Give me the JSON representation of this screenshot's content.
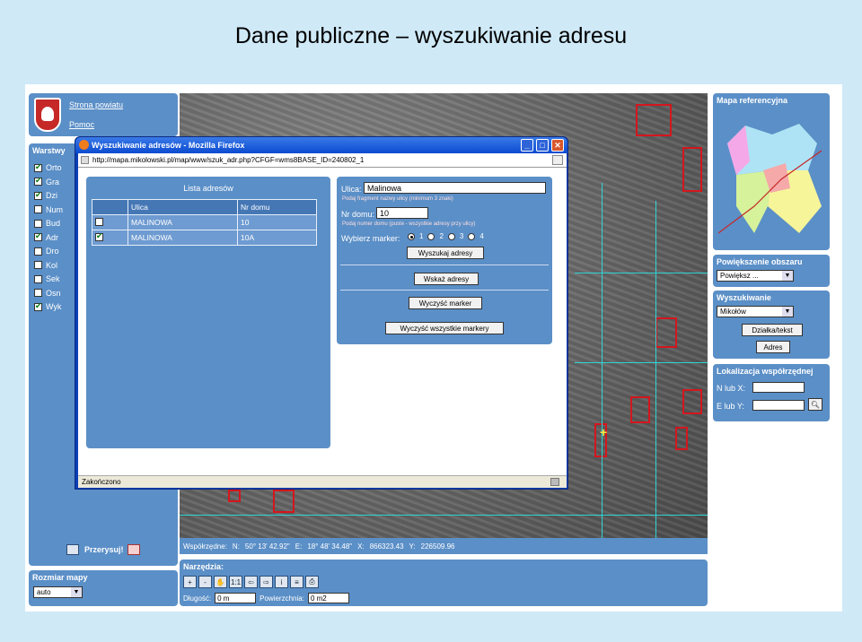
{
  "slide": {
    "title": "Dane publiczne – wyszukiwanie adresu"
  },
  "left_panel": {
    "links": [
      "Strona powiatu",
      "Pomoc"
    ],
    "layers_title": "Warstwy",
    "layers": [
      {
        "label": "Orto",
        "checked": true
      },
      {
        "label": "Gra",
        "checked": true
      },
      {
        "label": "Dzi",
        "checked": true
      },
      {
        "label": "Num",
        "checked": false
      },
      {
        "label": "Bud",
        "checked": false
      },
      {
        "label": "Adr",
        "checked": true
      },
      {
        "label": "Dro",
        "checked": false
      },
      {
        "label": "Kol",
        "checked": false
      },
      {
        "label": "Sek",
        "checked": false
      },
      {
        "label": "Osn",
        "checked": false
      },
      {
        "label": "Wyk",
        "checked": true
      }
    ],
    "redraw_label": "Przerysuj!",
    "map_size_title": "Rozmiar mapy",
    "map_size_value": "auto"
  },
  "coords_bar": {
    "label": "Współrzędne:",
    "n_label": "N:",
    "n_value": "50° 13' 42.92\"",
    "e_label": "E:",
    "e_value": "18° 48' 34.48\"",
    "x_label": "X:",
    "x_value": "866323.43",
    "y_label": "Y:",
    "y_value": "226509.96"
  },
  "tools": {
    "title": "Narzędzia:",
    "buttons": [
      "+",
      "-",
      "✋",
      "1:1",
      "⇦",
      "⇨",
      "i",
      "≡",
      "⎙"
    ],
    "length_label": "Długość:",
    "length_value": "0 m",
    "area_label": "Powierzchnia:",
    "area_value": "0 m2"
  },
  "right_panel": {
    "ref_title": "Mapa referencyjna",
    "zoom_title": "Powiększenie obszaru",
    "zoom_value": "Powiększ ...",
    "search_title": "Wyszukiwanie",
    "search_value": "Mikołów",
    "parcel_btn": "Działka/tekst",
    "address_btn": "Adres",
    "coord_title": "Lokalizacja współrzędnej",
    "n_label": "N lub X:",
    "e_label": "E lub Y:"
  },
  "window": {
    "title": "Wyszukiwanie adresów - Mozilla Firefox",
    "url": "http://mapa.mikolowski.pl/map/www/szuk_adr.php?CFGF=wms8BASE_ID=240802_1",
    "status": "Zakończono",
    "list_title": "Lista adresów",
    "table": {
      "headers": [
        "",
        "Ulica",
        "Nr domu"
      ],
      "rows": [
        {
          "checked": false,
          "street": "MALINOWA",
          "number": "10"
        },
        {
          "checked": true,
          "street": "MALINOWA",
          "number": "10A"
        }
      ]
    },
    "form": {
      "street_label": "Ulica:",
      "street_value": "Malinowa",
      "street_hint": "Podaj fragment nazwy ulicy (minimum 3 znaki)",
      "number_label": "Nr domu:",
      "number_value": "10",
      "number_hint": "Podaj numer domu (puste - wszystkie adresy przy ulicy)",
      "marker_label": "Wybierz marker:",
      "markers": [
        "1",
        "2",
        "3",
        "4"
      ],
      "marker_selected": 0,
      "search_btn": "Wyszukaj adresy",
      "show_btn": "Wskaż adresy",
      "clear_btn": "Wyczyść marker",
      "clear_all_btn": "Wyczyść wszystkie markery"
    }
  }
}
